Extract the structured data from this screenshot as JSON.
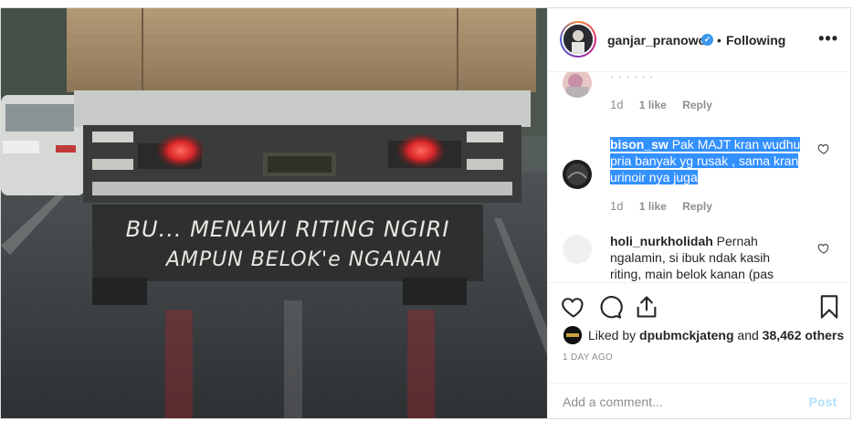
{
  "post": {
    "image_alt": "Rear of a truck on a rainy road with text painted on the bumper",
    "truck_text_line1": "BU... MENAWI RITING NGIRI",
    "truck_text_line2": "AMPUN BELOK'e NGANAN"
  },
  "header": {
    "username": "ganjar_pranowo",
    "verified_icon": "verified-badge-icon",
    "separator": "•",
    "follow_status": "Following",
    "more_icon": "more-options-icon"
  },
  "comments": [
    {
      "username": "",
      "text": "",
      "time": "1d",
      "likes": "1 like",
      "reply": "Reply"
    },
    {
      "username": "bison_sw",
      "text": "Pak MAJT kran wudhu pria banyak yg rusak , sama kran urinoir nya juga",
      "time": "1d",
      "likes": "1 like",
      "reply": "Reply"
    },
    {
      "username": "holi_nurkholidah",
      "text": "Pernah ngalamin, si ibuk ndak kasih riting, main belok kanan (pas"
    }
  ],
  "actions": {
    "like_icon": "heart-icon",
    "comment_icon": "comment-icon",
    "share_icon": "share-icon",
    "save_icon": "bookmark-icon"
  },
  "likes": {
    "prefix": "Liked by",
    "user": "dpubmckjateng",
    "connector": "and",
    "count": "38,462 others"
  },
  "date": "1 DAY AGO",
  "add_comment": {
    "placeholder": "Add a comment...",
    "post_label": "Post"
  },
  "colors": {
    "accent_blue": "#3897f0",
    "selection": "#3390ff",
    "muted": "#8e8e8e",
    "post_disabled": "#b2dffc"
  }
}
